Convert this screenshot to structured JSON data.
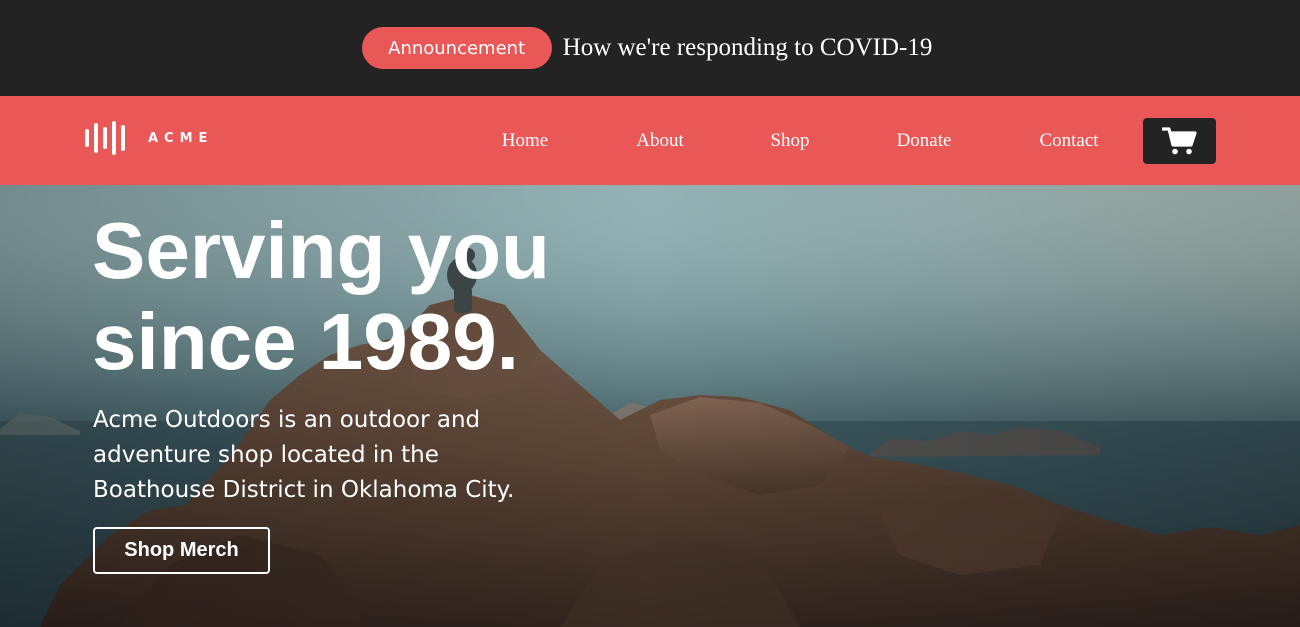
{
  "announcement": {
    "badge_label": "Announcement",
    "text": "How we're responding to COVID-19"
  },
  "nav": {
    "brand": "ACME",
    "logo_icon": "sound-wave-logo-icon",
    "links": [
      "Home",
      "About",
      "Shop",
      "Donate",
      "Contact"
    ],
    "cart_icon": "shopping-cart-icon"
  },
  "hero": {
    "title_line1": "Serving you",
    "title_line2": "since 1989.",
    "description": "Acme Outdoors is an outdoor and adventure shop located in the Boathouse District in Oklahoma City.",
    "button_label": "Shop Merch",
    "background": "hiker-on-coastal-rocks-photo"
  },
  "colors": {
    "accent": "#ea5757",
    "dark": "#232323",
    "text_light": "#ffffff"
  }
}
